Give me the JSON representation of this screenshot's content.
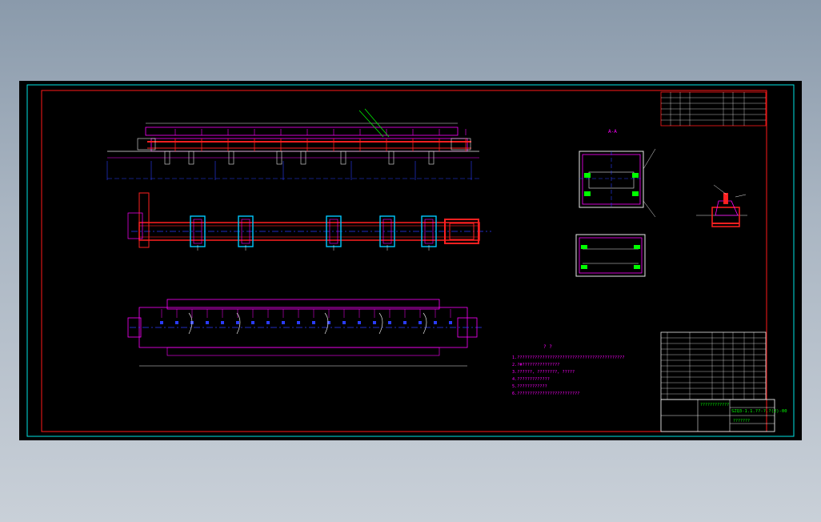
{
  "colors": {
    "background": "#000000",
    "frame_outer": "#00e5e5",
    "frame_inner": "#ff1a1a",
    "outline": "#ff00ff",
    "beam": "#ff2020",
    "centerline": "#2a3cff",
    "bracket": "#00c8ff",
    "text": "#00ff00",
    "line_white": "#e8e8e8"
  },
  "drawing": {
    "section_label": "A-A",
    "notes_heading": "? ?",
    "notes": [
      "1.???????????????????????????????????????????",
      "2.?#???????????????",
      "3.??????, ????????, ?????",
      "4.?????????????",
      "5.????????????",
      "6.?????????????????????????"
    ],
    "title_block": {
      "title": "????????????",
      "drawing_number": "SZQ3-1.1.??-?.?(2)-00",
      "sub": "???????"
    }
  }
}
